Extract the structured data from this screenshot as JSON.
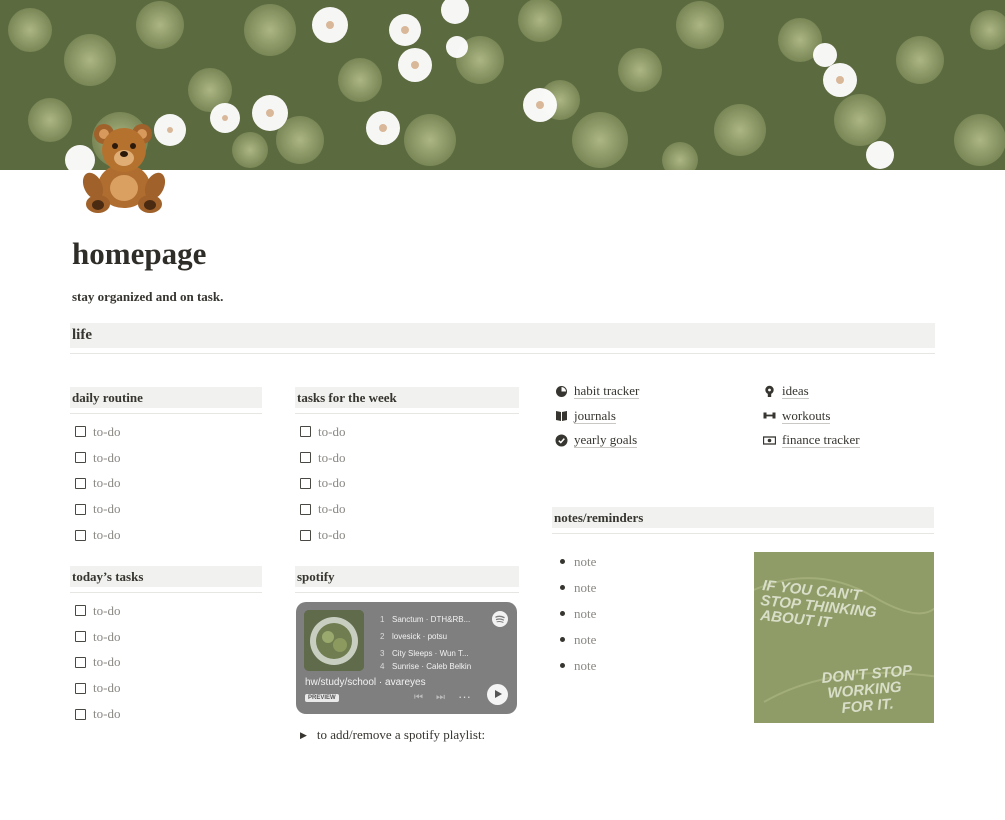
{
  "page": {
    "title": "homepage",
    "subtitle": "stay organized and on task.",
    "icon": "teddy-bear-icon"
  },
  "section": {
    "label": "life"
  },
  "daily_routine": {
    "heading": "daily routine",
    "items": [
      "to-do",
      "to-do",
      "to-do",
      "to-do",
      "to-do"
    ]
  },
  "tasks_week": {
    "heading": "tasks for the week",
    "items": [
      "to-do",
      "to-do",
      "to-do",
      "to-do",
      "to-do"
    ]
  },
  "todays_tasks": {
    "heading": "today’s tasks",
    "items": [
      "to-do",
      "to-do",
      "to-do",
      "to-do",
      "to-do"
    ]
  },
  "links_left": [
    {
      "label": "habit tracker",
      "icon": "pie-chart-icon"
    },
    {
      "label": "journals",
      "icon": "book-icon"
    },
    {
      "label": "yearly goals",
      "icon": "badge-check-icon"
    }
  ],
  "links_right": [
    {
      "label": "ideas",
      "icon": "lightbulb-icon"
    },
    {
      "label": "workouts",
      "icon": "dumbbell-icon"
    },
    {
      "label": "finance tracker",
      "icon": "money-icon"
    }
  ],
  "notes": {
    "heading": "notes/reminders",
    "items": [
      "note",
      "note",
      "note",
      "note",
      "note"
    ]
  },
  "quote_image": {
    "lines_top": [
      "IF YOU CAN'T",
      "STOP THINKING",
      "ABOUT IT"
    ],
    "lines_bottom": [
      "DON'T STOP",
      "WORKING",
      "FOR IT."
    ]
  },
  "spotify": {
    "heading": "spotify",
    "playlist": "hw/study/school · avareyes",
    "preview": "PREVIEW",
    "tracks": [
      {
        "num": "1",
        "name": "Sanctum · DTH&RB..."
      },
      {
        "num": "2",
        "name": "lovesick · potsu"
      },
      {
        "num": "3",
        "name": "City Sleeps · Wun T..."
      },
      {
        "num": "4",
        "name": "Sunrise · Caleb Belkin"
      }
    ],
    "toggle_label": "to add/remove a spotify playlist:"
  },
  "colors": {
    "block_bg": "#f1f1ef",
    "text": "#37352f",
    "muted": "#8a8883",
    "quote_bg": "#8f9c67",
    "spotify_bg": "#7f7f7f"
  }
}
